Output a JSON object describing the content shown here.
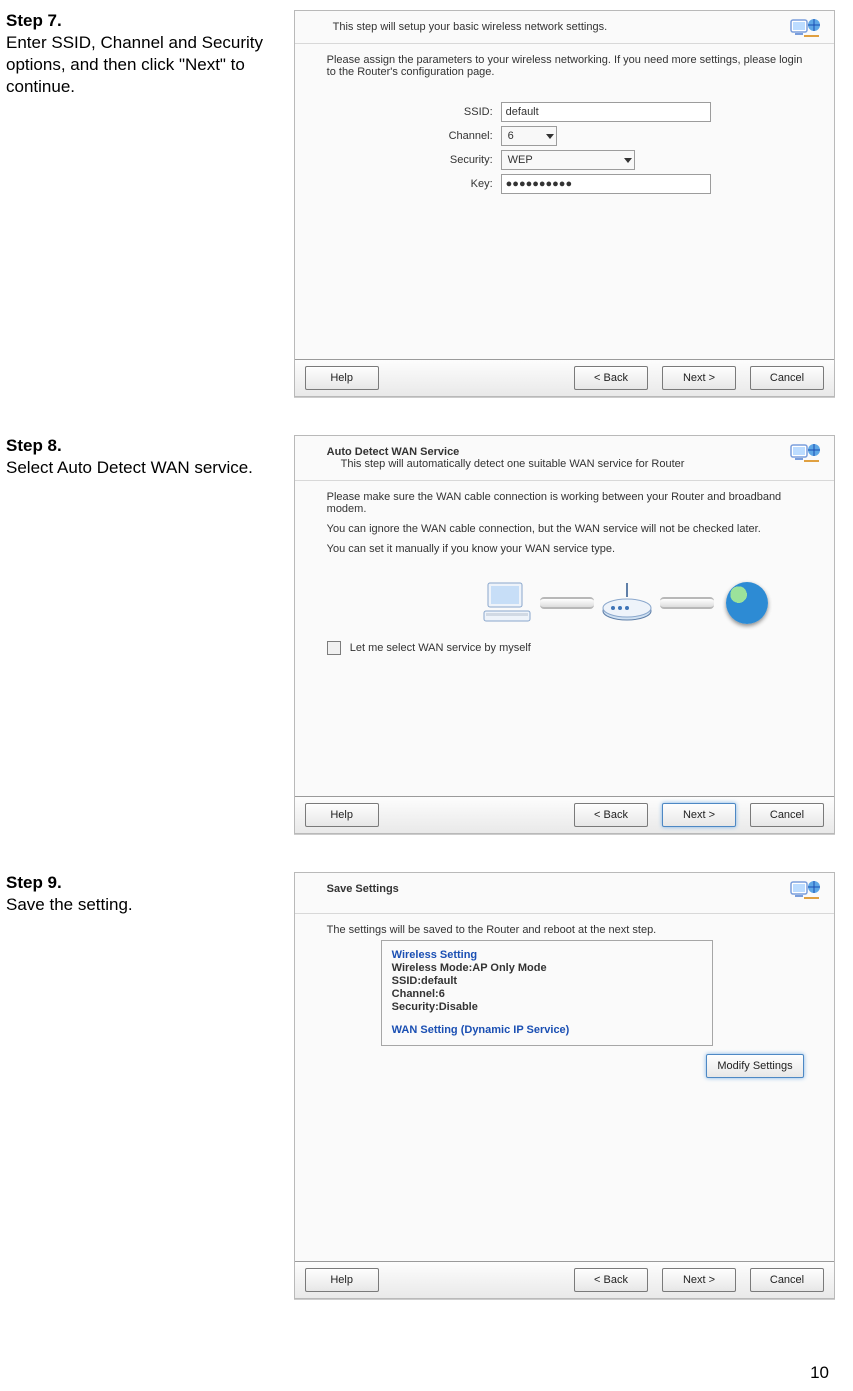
{
  "page_number": "10",
  "step7": {
    "title": "Step 7.",
    "desc": "Enter SSID, Channel and Security options, and then click \"Next\" to continue.",
    "panel_title": "This step will setup your basic wireless network settings.",
    "panel_text": "Please assign the parameters to your wireless networking. If you need more settings, please login to the Router's configuration page.",
    "labels": {
      "ssid": "SSID:",
      "channel": "Channel:",
      "security": "Security:",
      "key": "Key:"
    },
    "values": {
      "ssid": "default",
      "channel": "6",
      "security": "WEP",
      "key": "●●●●●●●●●●"
    },
    "buttons": {
      "help": "Help",
      "back": "< Back",
      "next": "Next >",
      "cancel": "Cancel"
    }
  },
  "step8": {
    "title": "Step 8.",
    "desc": "Select Auto Detect WAN service.",
    "panel_heading": "Auto Detect WAN Service",
    "panel_sub": "This step will automatically detect one suitable WAN service for Router",
    "line1": "Please make sure the WAN cable connection is working between your Router and broadband modem.",
    "line2": "You can ignore the WAN cable connection, but the WAN service will not be checked later.",
    "line3": "You can set it manually if you know your WAN service type.",
    "checkbox": "Let me select WAN service by myself",
    "buttons": {
      "help": "Help",
      "back": "< Back",
      "next": "Next >",
      "cancel": "Cancel"
    }
  },
  "step9": {
    "title": "Step 9.",
    "desc": "Save the setting.",
    "panel_heading": "Save Settings",
    "panel_text": "The settings will be saved to the Router and reboot at the next step.",
    "summary": {
      "wset": "Wireless Setting",
      "mode": "Wireless Mode:AP Only Mode",
      "ssid": "SSID:default",
      "channel": "Channel:6",
      "security": "Security:Disable",
      "wan": "WAN Setting  (Dynamic IP Service)"
    },
    "modify": "Modify Settings",
    "buttons": {
      "help": "Help",
      "back": "< Back",
      "next": "Next >",
      "cancel": "Cancel"
    }
  }
}
